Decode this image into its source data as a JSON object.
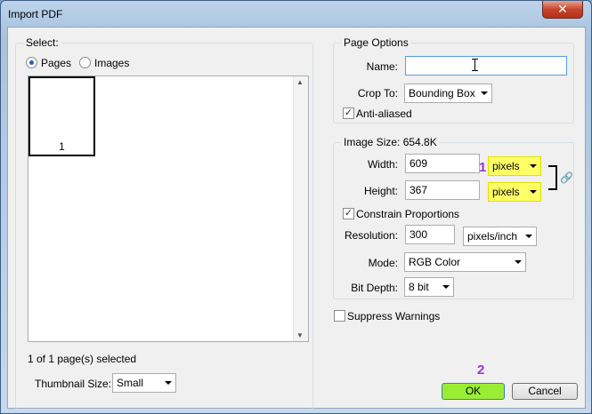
{
  "window": {
    "title": "Import PDF",
    "close_glyph": "✕"
  },
  "select_group": {
    "title": "Select:",
    "radio_pages": "Pages",
    "radio_images": "Images",
    "selected": "Pages",
    "thumbnails": [
      {
        "label": "1"
      }
    ],
    "status": "1 of 1 page(s) selected",
    "thumbnail_size_label": "Thumbnail Size:",
    "thumbnail_size_value": "Small"
  },
  "page_options": {
    "title": "Page Options",
    "name_label": "Name:",
    "name_value": "",
    "crop_to_label": "Crop To:",
    "crop_to_value": "Bounding Box",
    "anti_aliased_label": "Anti-aliased",
    "anti_aliased_checked": true
  },
  "image_size": {
    "title": "Image Size: 654.8K",
    "width_label": "Width:",
    "width_value": "609",
    "width_unit": "pixels",
    "height_label": "Height:",
    "height_value": "367",
    "height_unit": "pixels",
    "constrain_label": "Constrain Proportions",
    "constrain_checked": true,
    "resolution_label": "Resolution:",
    "resolution_value": "300",
    "resolution_unit": "pixels/inch",
    "mode_label": "Mode:",
    "mode_value": "RGB Color",
    "bit_depth_label": "Bit Depth:",
    "bit_depth_value": "8 bit"
  },
  "suppress_warnings": {
    "label": "Suppress Warnings",
    "checked": false
  },
  "buttons": {
    "ok": "OK",
    "cancel": "Cancel"
  },
  "annotations": {
    "marker_1": "1",
    "marker_2": "2",
    "highlight_color": "#ffff66",
    "marker_color": "#9b33d9",
    "ok_color": "#99ee33"
  },
  "icons": {
    "check_glyph": "✓",
    "link_glyph": "🔗"
  }
}
